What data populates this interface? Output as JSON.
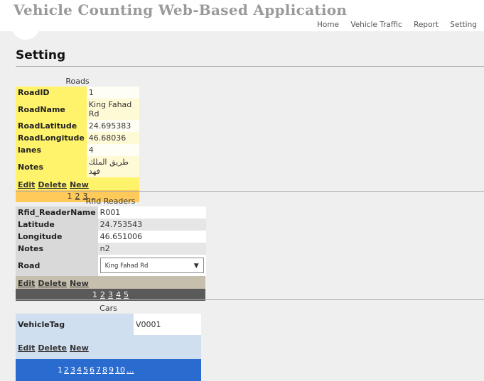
{
  "app_title": "Vehicle Counting Web-Based Application",
  "nav": {
    "home": "Home",
    "traffic": "Vehicle Traffic",
    "report": "Report",
    "setting": "Setting"
  },
  "page_title": "Setting",
  "roads": {
    "caption": "Roads",
    "rows": [
      {
        "label": "RoadID",
        "value": "1"
      },
      {
        "label": "RoadName",
        "value": "King Fahad Rd"
      },
      {
        "label": "RoadLatitude",
        "value": "24.695383"
      },
      {
        "label": "RoadLongitude",
        "value": "46.68036"
      },
      {
        "label": "lanes",
        "value": "4"
      },
      {
        "label": "Notes",
        "value": "طريق الملك فهد"
      }
    ],
    "edit": "Edit",
    "delete": "Delete",
    "new": "New",
    "pages": [
      "1",
      "2",
      "3"
    ]
  },
  "rfid": {
    "caption": "Rfid Readers",
    "rows": [
      {
        "label": "Rfid_ReaderName",
        "value": "R001"
      },
      {
        "label": "Latitude",
        "value": "24.753543"
      },
      {
        "label": "Longitude",
        "value": "46.651006"
      },
      {
        "label": "Notes",
        "value": "n2"
      }
    ],
    "road_label": "Road",
    "road_selected": "King Fahad Rd",
    "edit": "Edit",
    "delete": "Delete",
    "new": "New",
    "pages": [
      "1",
      "2",
      "3",
      "4",
      "5"
    ]
  },
  "cars": {
    "caption": "Cars",
    "label": "VehicleTag",
    "value": "V0001",
    "edit": "Edit",
    "delete": "Delete",
    "new": "New",
    "pages": [
      "1",
      "2",
      "3",
      "4",
      "5",
      "6",
      "7",
      "8",
      "9",
      "10",
      "..."
    ]
  }
}
